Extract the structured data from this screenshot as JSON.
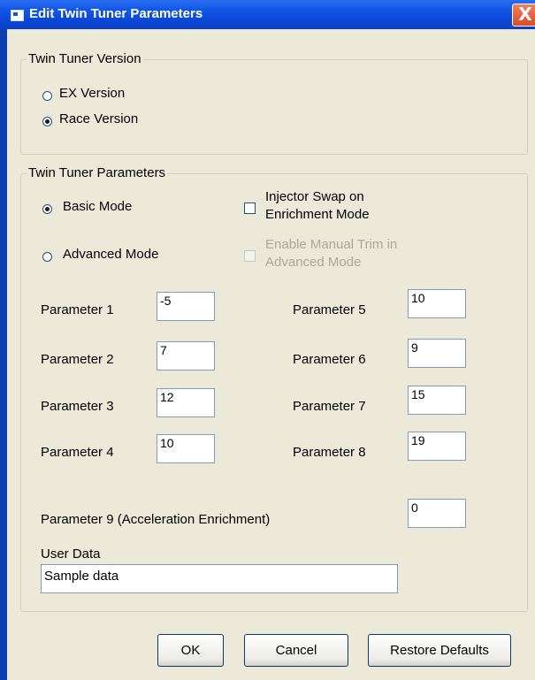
{
  "window": {
    "title": "Edit Twin Tuner Parameters",
    "close_symbol": "X"
  },
  "version_group": {
    "legend": "Twin Tuner  Version",
    "options": [
      {
        "label": "EX Version",
        "checked": false
      },
      {
        "label": "Race Version",
        "checked": true
      }
    ]
  },
  "params_group": {
    "legend": "Twin Tuner  Parameters",
    "modes": [
      {
        "label": "Basic Mode",
        "checked": true
      },
      {
        "label": "Advanced Mode",
        "checked": false
      }
    ],
    "injector_swap": {
      "line1": "Injector Swap on",
      "line2": "Enrichment Mode",
      "checked": false
    },
    "manual_trim": {
      "line1": "Enable Manual Trim in",
      "line2": "Advanced Mode",
      "checked": false,
      "enabled": false
    },
    "parameters": [
      {
        "label": "Parameter 1",
        "value": "-5"
      },
      {
        "label": "Parameter 2",
        "value": "7"
      },
      {
        "label": "Parameter 3",
        "value": "12"
      },
      {
        "label": "Parameter 4",
        "value": "10"
      },
      {
        "label": "Parameter 5",
        "value": "10"
      },
      {
        "label": "Parameter 6",
        "value": "9"
      },
      {
        "label": "Parameter 7",
        "value": "15"
      },
      {
        "label": "Parameter 8",
        "value": "19"
      }
    ],
    "parameter9": {
      "label": "Parameter 9 (Acceleration Enrichment)",
      "value": "0"
    },
    "user_data": {
      "label": "User Data",
      "value": "Sample data"
    }
  },
  "buttons": {
    "ok": "OK",
    "cancel": "Cancel",
    "restore": "Restore Defaults"
  }
}
